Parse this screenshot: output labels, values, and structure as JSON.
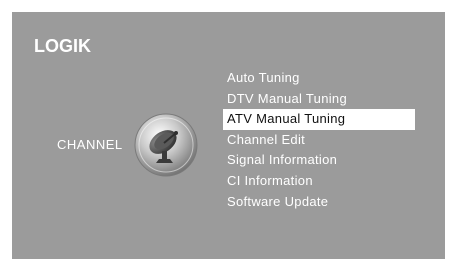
{
  "brand": {
    "logo_text": "LOGIK"
  },
  "section": {
    "label": "CHANNEL",
    "icon": "satellite-dish-icon"
  },
  "menu": {
    "selected_index": 2,
    "items": [
      {
        "label": "Auto Tuning"
      },
      {
        "label": "DTV Manual Tuning"
      },
      {
        "label": "ATV Manual Tuning"
      },
      {
        "label": "Channel Edit"
      },
      {
        "label": "Signal Information"
      },
      {
        "label": "CI Information"
      },
      {
        "label": "Software Update"
      }
    ]
  },
  "colors": {
    "screen_background": "#9b9b9b",
    "text": "#ffffff",
    "highlight_background": "#ffffff",
    "highlight_text": "#111111"
  }
}
